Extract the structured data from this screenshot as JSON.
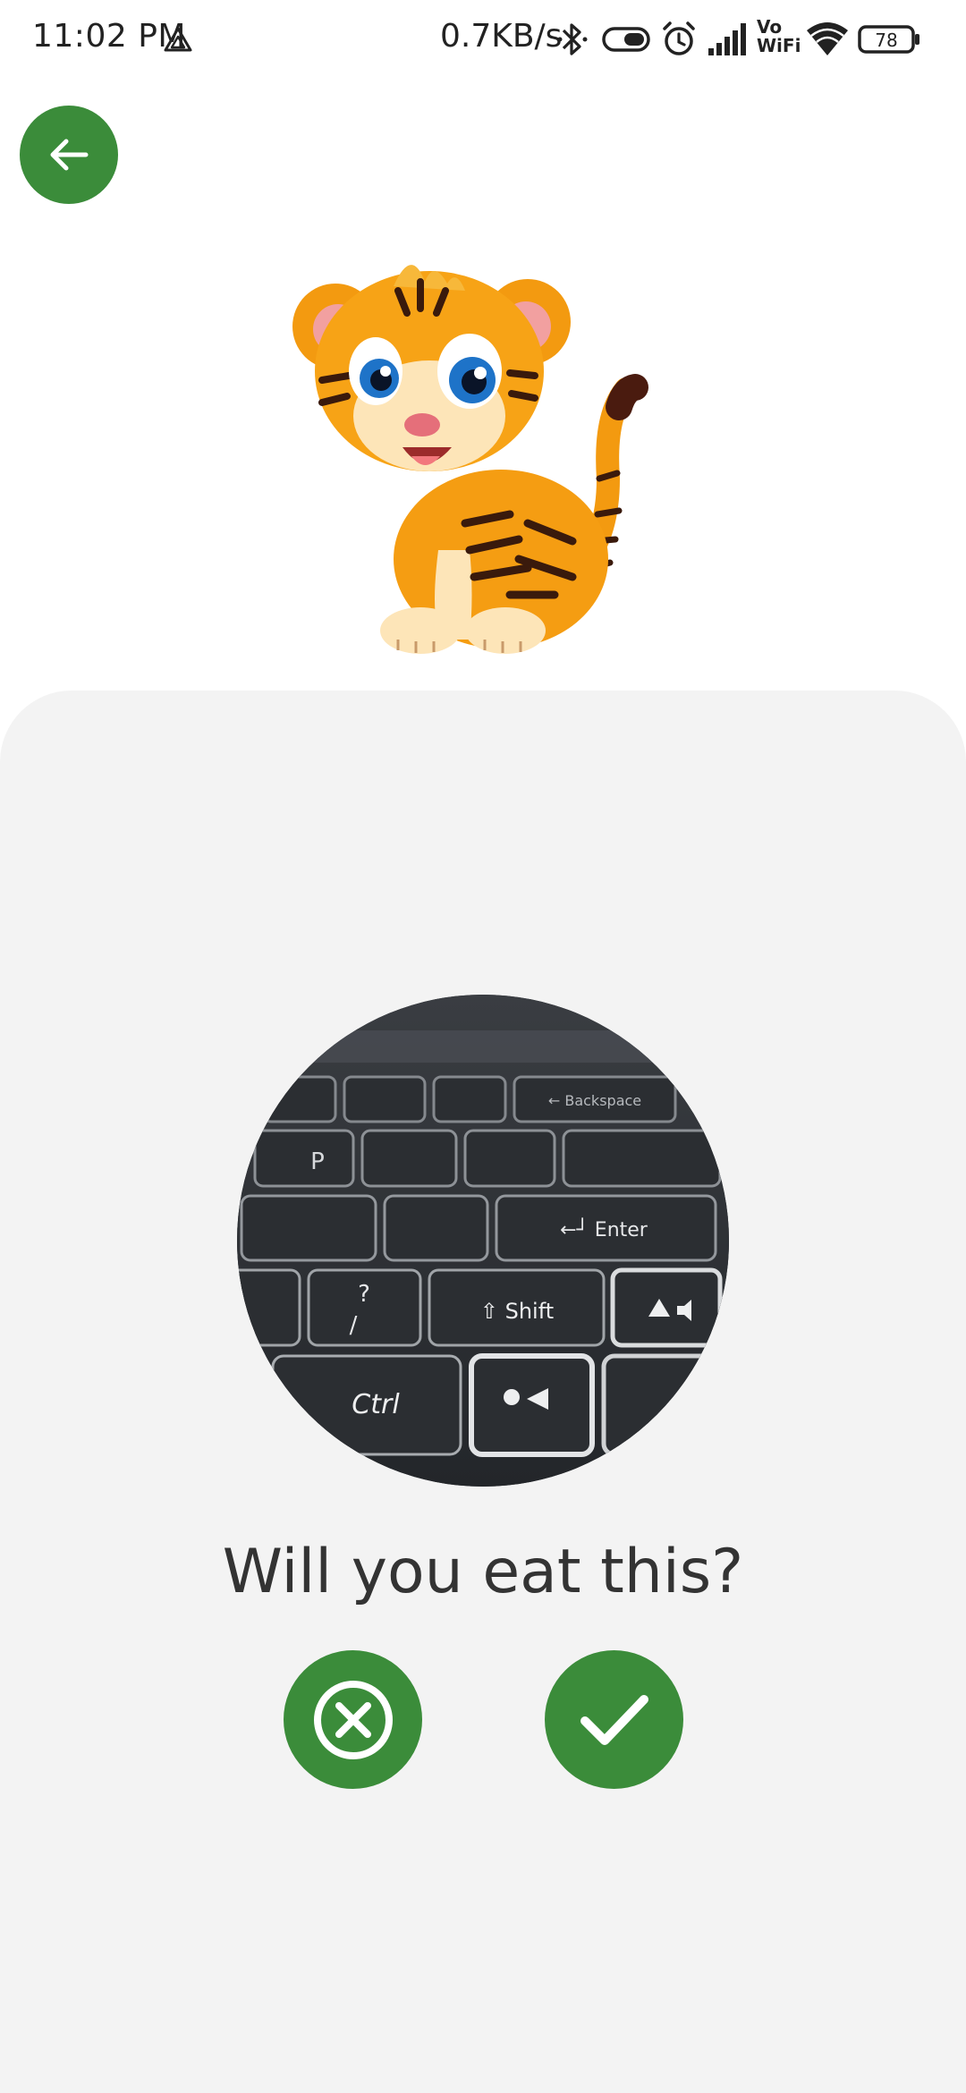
{
  "status_bar": {
    "time": "11:02 PM",
    "network_speed": "0.7KB/s",
    "vowifi_top": "Vo",
    "vowifi_bottom": "WiFi",
    "battery": "78"
  },
  "question": {
    "text": "Will you eat this?"
  },
  "keyboard_photo": {
    "keys": {
      "backspace": "← Backspace",
      "p": "P",
      "enter": "←┘ Enter",
      "question": "?",
      "slash": "/",
      "shift": "⇧ Shift",
      "ctrl": "Ctrl"
    }
  },
  "colors": {
    "accent": "#3b8c3a",
    "card_background": "#f3f3f3"
  },
  "icons": {
    "back": "arrow-left-icon",
    "no": "circle-x-icon",
    "yes": "check-icon"
  }
}
